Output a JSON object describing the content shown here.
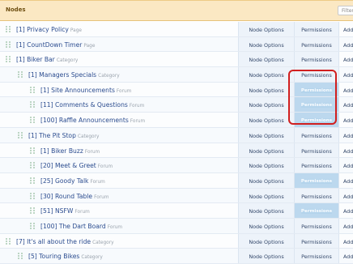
{
  "header": {
    "title": "Nodes",
    "filter_label": "Filter"
  },
  "actions": {
    "node_options": "Node Options",
    "permissions": "Permissions",
    "add": "Add"
  },
  "rows": [
    {
      "name": "[1] Privacy Policy",
      "type": "Page",
      "level": 0,
      "highlight": false
    },
    {
      "name": "[1] CountDown Timer",
      "type": "Page",
      "level": 0,
      "highlight": false
    },
    {
      "name": "[1] Biker Bar",
      "type": "Category",
      "level": 0,
      "highlight": false
    },
    {
      "name": "[1] Managers Specials",
      "type": "Category",
      "level": 1,
      "highlight": false
    },
    {
      "name": "[1] Site Announcements",
      "type": "Forum",
      "level": 2,
      "highlight": true
    },
    {
      "name": "[11] Comments & Questions",
      "type": "Forum",
      "level": 2,
      "highlight": true
    },
    {
      "name": "[100] Raffle Announcements",
      "type": "Forum",
      "level": 2,
      "highlight": true
    },
    {
      "name": "[1] The Pit Stop",
      "type": "Category",
      "level": 1,
      "highlight": false
    },
    {
      "name": "[1] Biker Buzz",
      "type": "Forum",
      "level": 2,
      "highlight": false
    },
    {
      "name": "[20] Meet & Greet",
      "type": "Forum",
      "level": 2,
      "highlight": false
    },
    {
      "name": "[25] Goody Talk",
      "type": "Forum",
      "level": 2,
      "highlight": true
    },
    {
      "name": "[30] Round Table",
      "type": "Forum",
      "level": 2,
      "highlight": false
    },
    {
      "name": "[51] NSFW",
      "type": "Forum",
      "level": 2,
      "highlight": true
    },
    {
      "name": "[100] The Dart Board",
      "type": "Forum",
      "level": 2,
      "highlight": false
    },
    {
      "name": "[7] It's all about the ride",
      "type": "Category",
      "level": 0,
      "highlight": false
    },
    {
      "name": "[5] Touring Bikes",
      "type": "Category",
      "level": 1,
      "highlight": false
    }
  ]
}
